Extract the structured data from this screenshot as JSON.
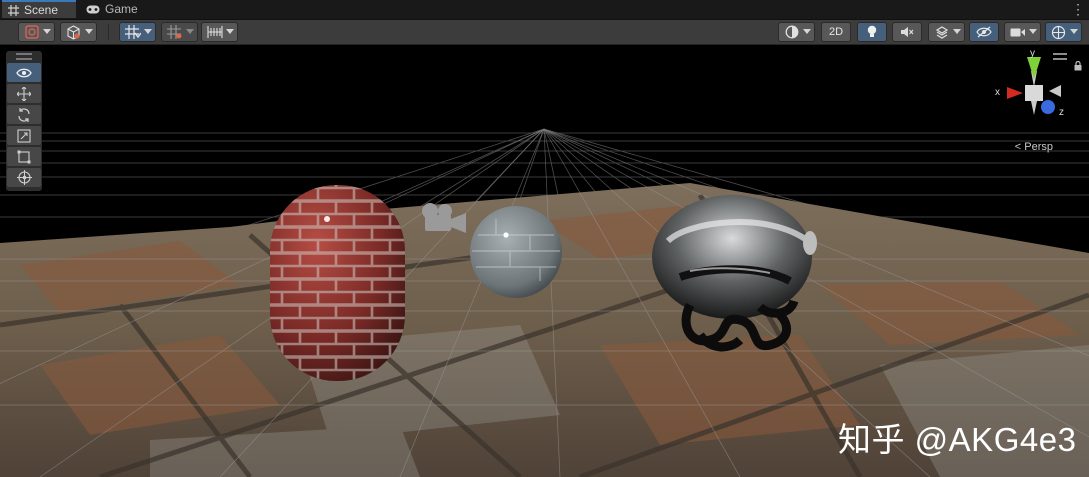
{
  "tabs": [
    {
      "label": "Scene",
      "icon": "grid-icon",
      "active": true
    },
    {
      "label": "Game",
      "icon": "gamepad-icon",
      "active": false
    }
  ],
  "toolbar": {
    "view_2d_label": "2D"
  },
  "gizmo": {
    "x_label": "x",
    "y_label": "y",
    "z_label": "z",
    "projection_label": "Persp"
  },
  "watermark": "知乎 @AKG4e3",
  "colors": {
    "accent_blue": "#3a79bb",
    "toggle_on": "#46607c",
    "axis_x": "#d12b23",
    "axis_y": "#7fd13a",
    "axis_z": "#3a6ae0"
  }
}
